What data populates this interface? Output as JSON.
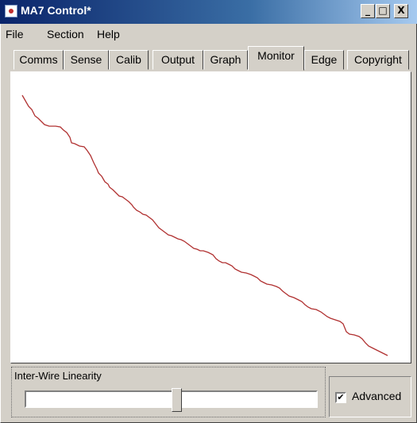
{
  "window": {
    "title": "MA7 Control*",
    "buttons": {
      "minimize": "_",
      "maximize": "□",
      "close": "X"
    }
  },
  "menu": [
    "File",
    "Section",
    "Help"
  ],
  "tabs": [
    "Comms",
    "Sense",
    "Calib",
    "Output",
    "Graph",
    "Monitor",
    "Edge",
    "Copyright"
  ],
  "active_tab": "Monitor",
  "graph": {
    "line_color": "#b03030"
  },
  "controls": {
    "group_label": "Inter-Wire Linearity",
    "slider_value": 0.52,
    "advanced_label": "Advanced",
    "advanced_checked": true,
    "check_mark": "✔"
  }
}
